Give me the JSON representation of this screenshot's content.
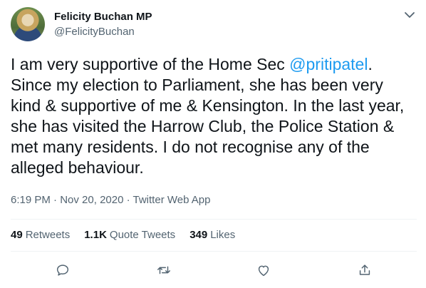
{
  "author": {
    "name": "Felicity Buchan MP",
    "handle": "@FelicityBuchan",
    "avatar_icon": "profile-photo"
  },
  "tweet": {
    "text_before": "I am very supportive of the Home Sec ",
    "mention": "@pritipatel",
    "text_after": ". Since my election to Parliament, she has been very kind & supportive of me & Kensington. In the last year, she has visited the Harrow Club, the Police Station & met many residents.  I do not recognise any of the alleged behaviour.",
    "time": "6:19 PM",
    "separator1": " · ",
    "date": "Nov 20, 2020",
    "separator2": " · ",
    "source": "Twitter Web App"
  },
  "stats": {
    "retweets_count": "49",
    "retweets_label": "Retweets",
    "quotes_count": "1.1K",
    "quotes_label": "Quote Tweets",
    "likes_count": "349",
    "likes_label": "Likes"
  },
  "actions": [
    "reply-icon",
    "retweet-icon",
    "like-icon",
    "share-icon"
  ],
  "colors": {
    "text": "#0f1419",
    "secondary": "#536471",
    "link": "#1d9bf0",
    "divider": "#eff3f4"
  }
}
